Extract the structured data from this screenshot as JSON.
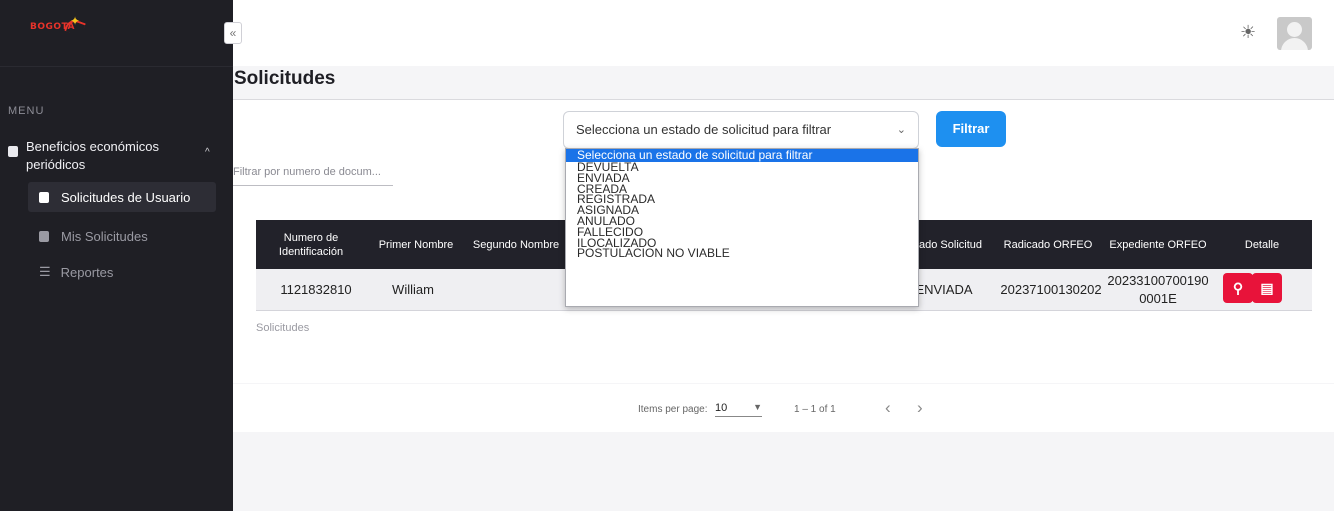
{
  "app": {
    "logo_text": "BOGOTÁ"
  },
  "sidebar": {
    "menu_label": "MENU",
    "group_label": "Beneficios económicos periódicos",
    "items": [
      {
        "label": "Solicitudes de Usuario",
        "active": true
      },
      {
        "label": "Mis Solicitudes",
        "active": false
      },
      {
        "label": "Reportes",
        "active": false
      }
    ]
  },
  "header": {
    "collapse_glyph": "«"
  },
  "page": {
    "title": "Solicitudes"
  },
  "filters": {
    "status_select_value": "Selecciona un estado de solicitud para filtrar",
    "filter_button": "Filtrar",
    "doc_placeholder": "Filtrar por numero de docum..."
  },
  "dropdown": {
    "options": [
      "Selecciona un estado de solicitud para filtrar",
      "DEVUELTA",
      "ENVIADA",
      "CREADA",
      "REGISTRADA",
      "ASIGNADA",
      "ANULADO",
      "FALLECIDO",
      "ILOCALIZADO",
      "POSTULACION NO VIABLE"
    ]
  },
  "table": {
    "headers": {
      "id": "Numero de Identificación",
      "first_name": "Primer Nombre",
      "second_name": "Segundo Nombre",
      "status": "tado Solicitud",
      "radicado": "Radicado ORFEO",
      "expediente": "Expediente ORFEO",
      "detalle": "Detalle"
    },
    "row": {
      "id": "1121832810",
      "first_name": "William",
      "status": "ENVIADA",
      "radicado": "20237100130202",
      "expediente": "202331007001900001E"
    },
    "caption": "Solicitudes"
  },
  "pagination": {
    "items_per_page_label": "Items per page:",
    "items_per_page_value": "10",
    "range": "1 – 1 of 1"
  }
}
